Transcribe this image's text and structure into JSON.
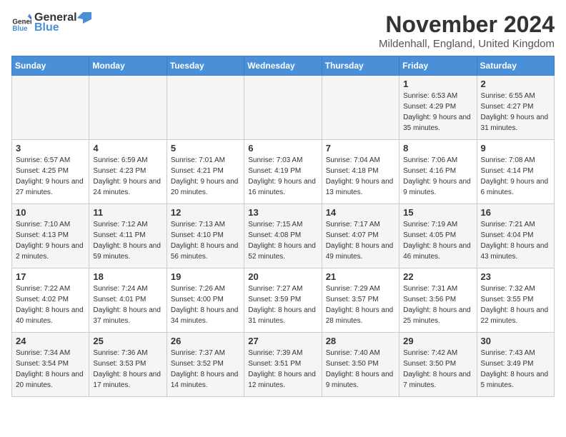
{
  "logo": {
    "text_general": "General",
    "text_blue": "Blue"
  },
  "title": "November 2024",
  "subtitle": "Mildenhall, England, United Kingdom",
  "days_of_week": [
    "Sunday",
    "Monday",
    "Tuesday",
    "Wednesday",
    "Thursday",
    "Friday",
    "Saturday"
  ],
  "weeks": [
    [
      {
        "day": "",
        "info": ""
      },
      {
        "day": "",
        "info": ""
      },
      {
        "day": "",
        "info": ""
      },
      {
        "day": "",
        "info": ""
      },
      {
        "day": "",
        "info": ""
      },
      {
        "day": "1",
        "info": "Sunrise: 6:53 AM\nSunset: 4:29 PM\nDaylight: 9 hours and 35 minutes."
      },
      {
        "day": "2",
        "info": "Sunrise: 6:55 AM\nSunset: 4:27 PM\nDaylight: 9 hours and 31 minutes."
      }
    ],
    [
      {
        "day": "3",
        "info": "Sunrise: 6:57 AM\nSunset: 4:25 PM\nDaylight: 9 hours and 27 minutes."
      },
      {
        "day": "4",
        "info": "Sunrise: 6:59 AM\nSunset: 4:23 PM\nDaylight: 9 hours and 24 minutes."
      },
      {
        "day": "5",
        "info": "Sunrise: 7:01 AM\nSunset: 4:21 PM\nDaylight: 9 hours and 20 minutes."
      },
      {
        "day": "6",
        "info": "Sunrise: 7:03 AM\nSunset: 4:19 PM\nDaylight: 9 hours and 16 minutes."
      },
      {
        "day": "7",
        "info": "Sunrise: 7:04 AM\nSunset: 4:18 PM\nDaylight: 9 hours and 13 minutes."
      },
      {
        "day": "8",
        "info": "Sunrise: 7:06 AM\nSunset: 4:16 PM\nDaylight: 9 hours and 9 minutes."
      },
      {
        "day": "9",
        "info": "Sunrise: 7:08 AM\nSunset: 4:14 PM\nDaylight: 9 hours and 6 minutes."
      }
    ],
    [
      {
        "day": "10",
        "info": "Sunrise: 7:10 AM\nSunset: 4:13 PM\nDaylight: 9 hours and 2 minutes."
      },
      {
        "day": "11",
        "info": "Sunrise: 7:12 AM\nSunset: 4:11 PM\nDaylight: 8 hours and 59 minutes."
      },
      {
        "day": "12",
        "info": "Sunrise: 7:13 AM\nSunset: 4:10 PM\nDaylight: 8 hours and 56 minutes."
      },
      {
        "day": "13",
        "info": "Sunrise: 7:15 AM\nSunset: 4:08 PM\nDaylight: 8 hours and 52 minutes."
      },
      {
        "day": "14",
        "info": "Sunrise: 7:17 AM\nSunset: 4:07 PM\nDaylight: 8 hours and 49 minutes."
      },
      {
        "day": "15",
        "info": "Sunrise: 7:19 AM\nSunset: 4:05 PM\nDaylight: 8 hours and 46 minutes."
      },
      {
        "day": "16",
        "info": "Sunrise: 7:21 AM\nSunset: 4:04 PM\nDaylight: 8 hours and 43 minutes."
      }
    ],
    [
      {
        "day": "17",
        "info": "Sunrise: 7:22 AM\nSunset: 4:02 PM\nDaylight: 8 hours and 40 minutes."
      },
      {
        "day": "18",
        "info": "Sunrise: 7:24 AM\nSunset: 4:01 PM\nDaylight: 8 hours and 37 minutes."
      },
      {
        "day": "19",
        "info": "Sunrise: 7:26 AM\nSunset: 4:00 PM\nDaylight: 8 hours and 34 minutes."
      },
      {
        "day": "20",
        "info": "Sunrise: 7:27 AM\nSunset: 3:59 PM\nDaylight: 8 hours and 31 minutes."
      },
      {
        "day": "21",
        "info": "Sunrise: 7:29 AM\nSunset: 3:57 PM\nDaylight: 8 hours and 28 minutes."
      },
      {
        "day": "22",
        "info": "Sunrise: 7:31 AM\nSunset: 3:56 PM\nDaylight: 8 hours and 25 minutes."
      },
      {
        "day": "23",
        "info": "Sunrise: 7:32 AM\nSunset: 3:55 PM\nDaylight: 8 hours and 22 minutes."
      }
    ],
    [
      {
        "day": "24",
        "info": "Sunrise: 7:34 AM\nSunset: 3:54 PM\nDaylight: 8 hours and 20 minutes."
      },
      {
        "day": "25",
        "info": "Sunrise: 7:36 AM\nSunset: 3:53 PM\nDaylight: 8 hours and 17 minutes."
      },
      {
        "day": "26",
        "info": "Sunrise: 7:37 AM\nSunset: 3:52 PM\nDaylight: 8 hours and 14 minutes."
      },
      {
        "day": "27",
        "info": "Sunrise: 7:39 AM\nSunset: 3:51 PM\nDaylight: 8 hours and 12 minutes."
      },
      {
        "day": "28",
        "info": "Sunrise: 7:40 AM\nSunset: 3:50 PM\nDaylight: 8 hours and 9 minutes."
      },
      {
        "day": "29",
        "info": "Sunrise: 7:42 AM\nSunset: 3:50 PM\nDaylight: 8 hours and 7 minutes."
      },
      {
        "day": "30",
        "info": "Sunrise: 7:43 AM\nSunset: 3:49 PM\nDaylight: 8 hours and 5 minutes."
      }
    ]
  ]
}
